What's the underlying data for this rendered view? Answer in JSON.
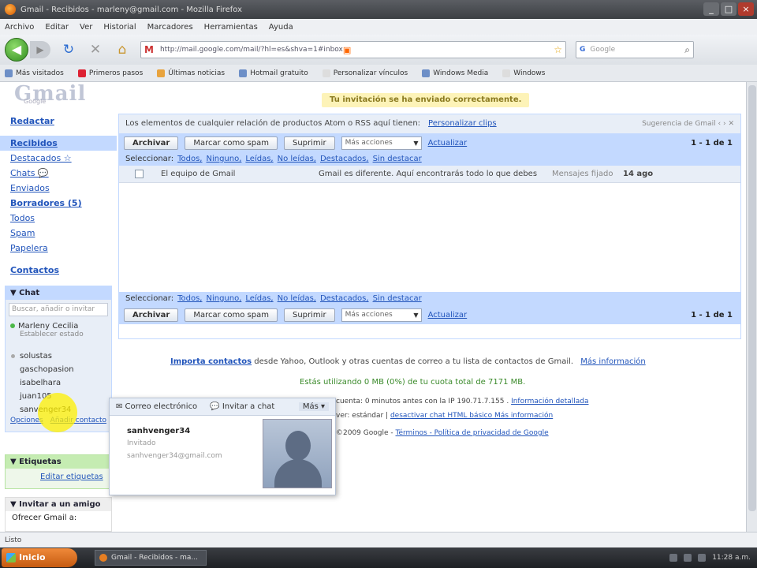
{
  "window": {
    "title": "Gmail - Recibidos - marleny@gmail.com - Mozilla Firefox",
    "buttons": [
      "_",
      "□",
      "×"
    ]
  },
  "menubar": [
    "Archivo",
    "Editar",
    "Ver",
    "Historial",
    "Marcadores",
    "Herramientas",
    "Ayuda"
  ],
  "navbar": {
    "url": "http://mail.google.com/mail/?hl=es&shva=1#inbox",
    "search_placeholder": "Google"
  },
  "bookmarks": [
    "Más visitados",
    "Primeros pasos",
    "Últimas noticias",
    "Hotmail gratuito",
    "Personalizar vínculos",
    "Windows Media",
    "Windows"
  ],
  "gmail": {
    "logo": "Gmail",
    "logo_sub": "Google",
    "notice": "Tu invitación se ha enviado correctamente.",
    "nav": [
      {
        "label": "Redactar",
        "style": "bold"
      },
      {
        "label": "Recibidos",
        "style": "sel"
      },
      {
        "label": "Destacados ☆",
        "style": ""
      },
      {
        "label": "Chats 💬",
        "style": ""
      },
      {
        "label": "Enviados",
        "style": ""
      },
      {
        "label": "Borradores (5)",
        "style": "bold"
      },
      {
        "label": "Todos",
        "style": ""
      },
      {
        "label": "Spam",
        "style": ""
      },
      {
        "label": "Papelera",
        "style": ""
      }
    ],
    "contacts_link": "Contactos",
    "chat": {
      "header": "▼ Chat",
      "search_placeholder": "Buscar, añadir o invitar",
      "me": "Marleny Cecilia",
      "status": "Establecer estado",
      "contacts": [
        "solustas",
        "gaschopasion",
        "isabelhara",
        "juan105",
        "sanvenger34"
      ],
      "options_link": "Opciones",
      "add_link": "Añadir contacto"
    },
    "labels": {
      "header": "▼ Etiquetas",
      "edit": "Editar etiquetas"
    },
    "invite": {
      "header": "▼ Invitar a un amigo",
      "text": "Ofrecer Gmail a:"
    },
    "clip": {
      "text": "Los elementos de cualquier relación de productos Atom o RSS aquí tienen:",
      "link": "Personalizar clips",
      "right": "Sugerencia de Gmail"
    },
    "toolbar": {
      "archive": "Archivar",
      "spam": "Marcar como spam",
      "delete": "Suprimir",
      "more": "Más acciones",
      "refresh": "Actualizar",
      "count": "1 - 1 de 1"
    },
    "select": {
      "label": "Seleccionar:",
      "options": [
        "Todos,",
        "Ninguno,",
        "Leídas,",
        "No leídas,",
        "Destacados,",
        "Sin destacar"
      ]
    },
    "mail": {
      "from": "El equipo de Gmail",
      "subject": "Gmail es diferente. Aquí encontrarás todo lo que debes saber.",
      "label": "Mensajes fijado",
      "date": "14 ago"
    },
    "import_line": {
      "link": "Importa contactos",
      "text": "desde Yahoo, Outlook y otras cuentas de correo a tu lista de contactos de Gmail.",
      "more": "Más información"
    },
    "usage": "Estás utilizando 0 MB (0%) de tu cuota total de 7171 MB.",
    "footer_lines": [
      {
        "text": "cuenta: 0 minutos antes con la IP 190.71.7.155 .",
        "link": "Información detallada"
      },
      {
        "text": "ver: estándar |",
        "link": "desactivar chat  HTML básico  Más información"
      },
      {
        "text": "©2009 Google -",
        "link": "Términos  -  Política de privacidad de Google"
      }
    ],
    "card": {
      "email_btn": "✉ Correo electrónico",
      "chat_btn": "💬 Invitar a chat",
      "more_btn": "Más ▾",
      "name": "sanhvenger34",
      "status": "Invitado",
      "email": "sanhvenger34@gmail.com"
    }
  },
  "statusbar": "Listo",
  "taskbar": {
    "start": "Inicio",
    "task": "Gmail - Recibidos - ma...",
    "clock": "11:28 a.m."
  }
}
